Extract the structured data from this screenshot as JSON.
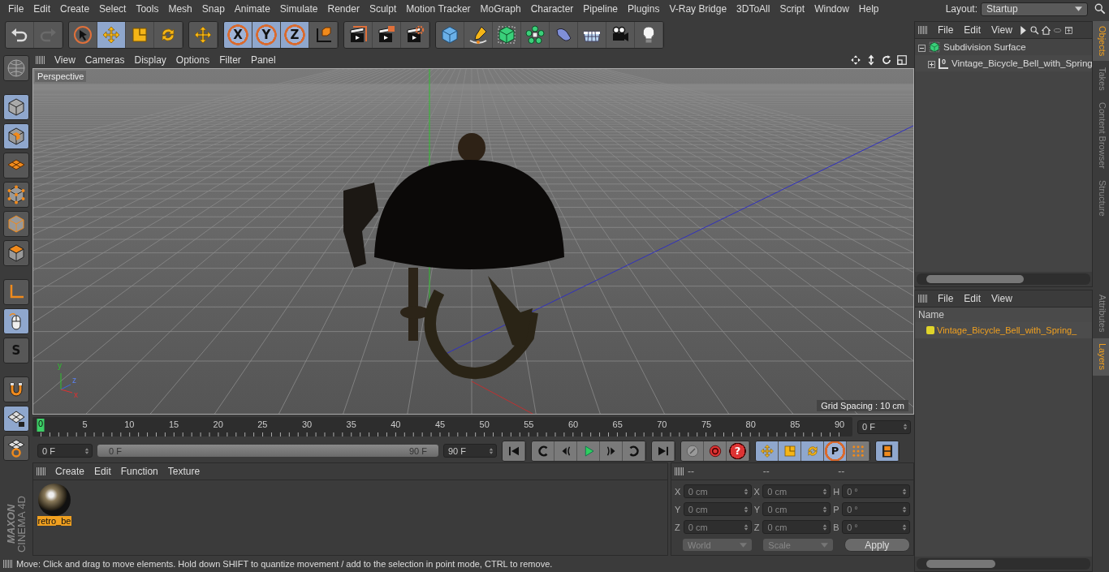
{
  "menu": [
    "File",
    "Edit",
    "Create",
    "Select",
    "Tools",
    "Mesh",
    "Snap",
    "Animate",
    "Simulate",
    "Render",
    "Sculpt",
    "Motion Tracker",
    "MoGraph",
    "Character",
    "Pipeline",
    "Plugins",
    "V-Ray Bridge",
    "3DToAll",
    "Script",
    "Window",
    "Help"
  ],
  "layout": {
    "label": "Layout:",
    "value": "Startup"
  },
  "toolbar": [
    [
      {
        "kind": "undo",
        "selected": false,
        "disabled": false
      },
      {
        "kind": "redo",
        "selected": false,
        "disabled": true
      }
    ],
    [
      {
        "kind": "arrow-cursor",
        "selected": false,
        "disabled": false
      },
      {
        "kind": "move",
        "selected": true,
        "disabled": false
      },
      {
        "kind": "scale",
        "selected": false,
        "disabled": false
      },
      {
        "kind": "rotate",
        "selected": false,
        "disabled": false
      }
    ],
    [
      {
        "kind": "move",
        "selected": false,
        "disabled": false
      }
    ],
    [
      {
        "kind": "axis-letter",
        "label": "X",
        "selected": true,
        "disabled": false
      },
      {
        "kind": "axis-letter",
        "label": "Y",
        "selected": true,
        "disabled": false
      },
      {
        "kind": "axis-letter",
        "label": "Z",
        "selected": true,
        "disabled": false
      },
      {
        "kind": "axes-cube",
        "selected": false,
        "disabled": false
      }
    ],
    [
      {
        "kind": "clapperboard-window",
        "selected": false,
        "disabled": false
      },
      {
        "kind": "clapperboard",
        "selected": false,
        "disabled": false
      },
      {
        "kind": "clapperboard-gear",
        "selected": false,
        "disabled": false
      }
    ],
    [
      {
        "kind": "cube",
        "selected": false,
        "disabled": false
      },
      {
        "kind": "pen",
        "selected": false,
        "disabled": false
      },
      {
        "kind": "subdivision-cube",
        "selected": false,
        "disabled": false
      },
      {
        "kind": "flower",
        "selected": false,
        "disabled": false
      },
      {
        "kind": "bent-shape",
        "selected": false,
        "disabled": false
      },
      {
        "kind": "floor-grid",
        "selected": false,
        "disabled": false
      },
      {
        "kind": "camera",
        "selected": false,
        "disabled": false
      },
      {
        "kind": "light-bulb",
        "selected": false,
        "disabled": false
      }
    ]
  ],
  "left_tools": [
    {
      "kind": "globe",
      "selected": false
    },
    {
      "kind": "cube-outline",
      "selected": true
    },
    {
      "kind": "checker-cube",
      "selected": true
    },
    {
      "kind": "grid-plane",
      "selected": false
    },
    {
      "kind": "cube-points",
      "selected": false
    },
    {
      "kind": "cube-edges",
      "selected": false
    },
    {
      "kind": "cube-polygons",
      "selected": false
    },
    {
      "kind": "axis-corner",
      "selected": false
    },
    {
      "kind": "mouse",
      "selected": true
    },
    {
      "kind": "solo-letter",
      "label": "S",
      "selected": false
    },
    {
      "kind": "magnet",
      "selected": false
    },
    {
      "kind": "grid-lock",
      "selected": true
    },
    {
      "kind": "grid-snap",
      "selected": false
    }
  ],
  "logo": [
    "MAXON",
    "CINEMA 4D"
  ],
  "viewport": {
    "menu": [
      "View",
      "Cameras",
      "Display",
      "Options",
      "Filter",
      "Panel"
    ],
    "nav": [
      {
        "kind": "pan-arrows"
      },
      {
        "kind": "updown-arrows"
      },
      {
        "kind": "orbit"
      },
      {
        "kind": "maximize"
      }
    ],
    "camera": "Perspective",
    "grid_spacing": "Grid Spacing : 10 cm",
    "axis_labels": [
      "y",
      "z",
      "x"
    ]
  },
  "timeline": {
    "ticks": [
      "5",
      "10",
      "15",
      "20",
      "25",
      "30",
      "35",
      "40",
      "45",
      "50",
      "55",
      "60",
      "65",
      "70",
      "75",
      "80",
      "85",
      "90"
    ],
    "playhead": {
      "label": "0",
      "level": 0
    },
    "frame": "0 F",
    "start": "0 F",
    "range": {
      "start": "0 F",
      "end": "90 F",
      "level": 1
    },
    "end": "90 F"
  },
  "transport": [
    [
      {
        "kind": "skip-start",
        "selected": false
      }
    ],
    [
      {
        "kind": "key-back",
        "selected": false
      },
      {
        "kind": "frame-back",
        "selected": false
      },
      {
        "kind": "play",
        "selected": false
      },
      {
        "kind": "frame-forward",
        "selected": false
      },
      {
        "kind": "key-forward",
        "selected": false
      }
    ],
    [
      {
        "kind": "skip-end",
        "selected": false
      }
    ],
    [
      {
        "kind": "record-off",
        "selected": false
      },
      {
        "kind": "record",
        "selected": false
      },
      {
        "kind": "help-letter",
        "label": "?",
        "selected": false
      }
    ],
    [
      {
        "kind": "move",
        "selected": true
      },
      {
        "kind": "scale",
        "selected": true
      },
      {
        "kind": "rotate",
        "selected": true
      },
      {
        "kind": "param-letter",
        "label": "P",
        "selected": true
      },
      {
        "kind": "dots-grid",
        "selected": false
      }
    ],
    [
      {
        "kind": "film-strip",
        "selected": true
      }
    ]
  ],
  "materials": {
    "menu": [
      "Create",
      "Edit",
      "Function",
      "Texture"
    ],
    "items": [
      {
        "name": "retro_be",
        "selected": true
      }
    ]
  },
  "coordinates": {
    "headers": [
      "--",
      "--",
      "--"
    ],
    "rows": [
      [
        {
          "label": "X",
          "value": "0 cm"
        },
        {
          "label": "X",
          "value": "0 cm"
        },
        {
          "label": "H",
          "value": "0 °"
        }
      ],
      [
        {
          "label": "Y",
          "value": "0 cm"
        },
        {
          "label": "Y",
          "value": "0 cm"
        },
        {
          "label": "P",
          "value": "0 °"
        }
      ],
      [
        {
          "label": "Z",
          "value": "0 cm"
        },
        {
          "label": "Z",
          "value": "0 cm"
        },
        {
          "label": "B",
          "value": "0 °"
        }
      ]
    ],
    "modes": [
      "World",
      "Scale"
    ],
    "apply": "Apply"
  },
  "status": "Move: Click and drag to move elements. Hold down SHIFT to quantize movement / add to the selection in point mode, CTRL to remove.",
  "objects": {
    "menu": [
      "File",
      "Edit",
      "View"
    ],
    "tree": [
      {
        "name": "Subdivision Surface",
        "expanded": true,
        "children": [
          {
            "name": "Vintage_Bicycle_Bell_with_Spring",
            "icon_label": "0",
            "expanded": false
          }
        ]
      }
    ],
    "tabs": [
      {
        "label": "Objects",
        "selected": true
      },
      {
        "label": "Takes",
        "selected": false
      },
      {
        "label": "Content Browser",
        "selected": false
      },
      {
        "label": "Structure",
        "selected": false
      }
    ]
  },
  "layers": {
    "menu": [
      "File",
      "Edit",
      "View"
    ],
    "header": "Name",
    "items": [
      {
        "name": "Vintage_Bicycle_Bell_with_Spring_",
        "color": "#e0d42a"
      }
    ],
    "tabs": [
      {
        "label": "Attributes",
        "selected": false
      },
      {
        "label": "Layers",
        "selected": true
      }
    ]
  }
}
